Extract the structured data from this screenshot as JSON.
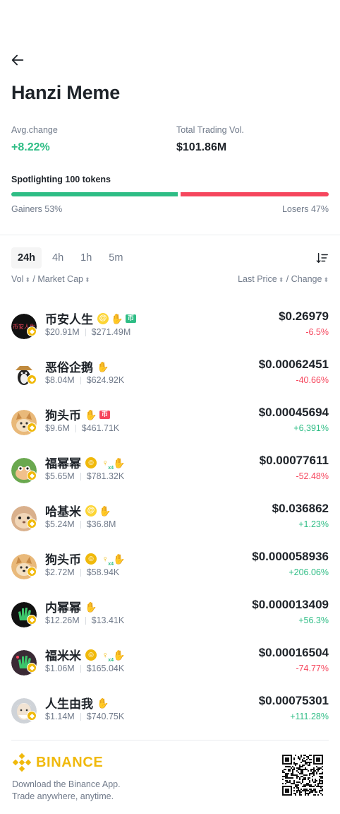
{
  "page": {
    "title": "Hanzi Meme",
    "back_icon": "arrow-left-icon"
  },
  "stats": {
    "avg_change_label": "Avg.change",
    "avg_change_value": "+8.22%",
    "volume_label": "Total Trading Vol.",
    "volume_value": "$101.86M"
  },
  "spotlight": {
    "label": "Spotlighting 100 tokens",
    "gainers_label": "Gainers 53%",
    "losers_label": "Losers 47%",
    "gainers_fraction": 0.53,
    "losers_fraction": 0.47,
    "gain_color": "#2ebd85",
    "loss_color": "#f6465d"
  },
  "tabs": [
    "24h",
    "4h",
    "1h",
    "5m"
  ],
  "active_tab": "24h",
  "columns": {
    "vol": "Vol",
    "market_cap": "/ Market Cap",
    "last_price": "Last Price",
    "change": "/ Change"
  },
  "tokens": [
    {
      "name": "币安人生",
      "volume": "$20.91M",
      "market_cap": "$271.49M",
      "price": "$0.26979",
      "change": "-6.5%",
      "direction": "down",
      "tags": [
        "at",
        "hand",
        "flag-g"
      ],
      "avatar": "black-circle-text"
    },
    {
      "name": "恶俗企鹅",
      "volume": "$8.04M",
      "market_cap": "$624.92K",
      "price": "$0.00062451",
      "change": "-40.66%",
      "direction": "down",
      "tags": [
        "hand"
      ],
      "avatar": "penguin-hat"
    },
    {
      "name": "狗头币",
      "volume": "$9.6M",
      "market_cap": "$461.71K",
      "price": "$0.00045694",
      "change": "+6,391%",
      "direction": "up",
      "tags": [
        "hand",
        "flag-r"
      ],
      "avatar": "shiba-dog"
    },
    {
      "name": "福幂幂",
      "volume": "$5.65M",
      "market_cap": "$781.32K",
      "price": "$0.00077611",
      "change": "-52.48%",
      "direction": "down",
      "tags": [
        "rank",
        "boost",
        "hand"
      ],
      "avatar": "pepe-cat"
    },
    {
      "name": "哈基米",
      "volume": "$5.24M",
      "market_cap": "$36.8M",
      "price": "$0.036862",
      "change": "+1.23%",
      "direction": "up",
      "tags": [
        "at",
        "hand"
      ],
      "avatar": "hamster"
    },
    {
      "name": "狗头币",
      "volume": "$2.72M",
      "market_cap": "$58.94K",
      "price": "$0.000058936",
      "change": "+206.06%",
      "direction": "up",
      "tags": [
        "rank",
        "boost",
        "hand"
      ],
      "avatar": "shiba-dog"
    },
    {
      "name": "内幂幂",
      "volume": "$12.26M",
      "market_cap": "$13.41K",
      "price": "$0.000013409",
      "change": "+56.3%",
      "direction": "up",
      "tags": [
        "hand"
      ],
      "avatar": "green-hand"
    },
    {
      "name": "福米米",
      "volume": "$1.06M",
      "market_cap": "$165.04K",
      "price": "$0.00016504",
      "change": "-74.77%",
      "direction": "down",
      "tags": [
        "rank",
        "boost",
        "hand"
      ],
      "avatar": "green-hand-dark"
    },
    {
      "name": "人生由我",
      "volume": "$1.14M",
      "market_cap": "$740.75K",
      "price": "$0.00075301",
      "change": "+111.28%",
      "direction": "up",
      "tags": [
        "hand"
      ],
      "avatar": "old-man"
    }
  ],
  "tag_glyphs": {
    "at": "@",
    "hand": "✋",
    "rank": "◎",
    "boost": "♀",
    "boost_sub": "x4",
    "flag": "币"
  },
  "footer": {
    "brand": "BINANCE",
    "line1": "Download the Binance App.",
    "line2": "Trade anywhere, anytime.",
    "qr_icon": "qr-code-icon",
    "brand_color": "#f0b90b"
  }
}
